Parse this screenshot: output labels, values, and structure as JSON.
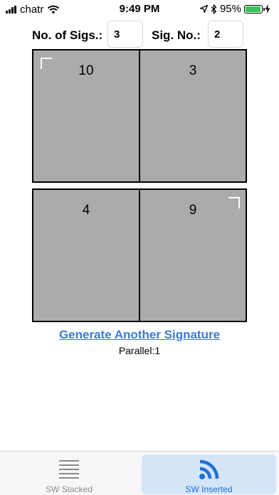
{
  "status_bar": {
    "carrier": "chatr",
    "time": "9:49 PM",
    "battery_percent": "95%",
    "battery_level": 0.95,
    "battery_color": "#35c759",
    "icons": [
      "signal-icon",
      "wifi-icon",
      "location-icon",
      "bluetooth-icon",
      "battery-icon",
      "charging-icon"
    ]
  },
  "params": {
    "num_sigs_label": "No. of Sigs.:",
    "num_sigs_value": "3",
    "sig_no_label": "Sig. No.:",
    "sig_no_value": "2"
  },
  "sheets": [
    {
      "left_page": "10",
      "right_page": "3",
      "corner_mark": "top-left"
    },
    {
      "left_page": "4",
      "right_page": "9",
      "corner_mark": "top-right"
    }
  ],
  "colors": {
    "page_fill": "#ababab",
    "link": "#3a7bd5",
    "active_tab_bg": "#d4e5f8",
    "active_tab_text": "#1e6fd9",
    "inactive_tab_text": "#8a8a8a"
  },
  "actions": {
    "generate_label": "Generate Another Signature",
    "parallel_text": "Parallel:1"
  },
  "tabs": [
    {
      "label": "SW Stacked",
      "icon": "stacked-lines-icon",
      "active": false
    },
    {
      "label": "SW Inserted",
      "icon": "rss-feed-icon",
      "active": true
    }
  ]
}
